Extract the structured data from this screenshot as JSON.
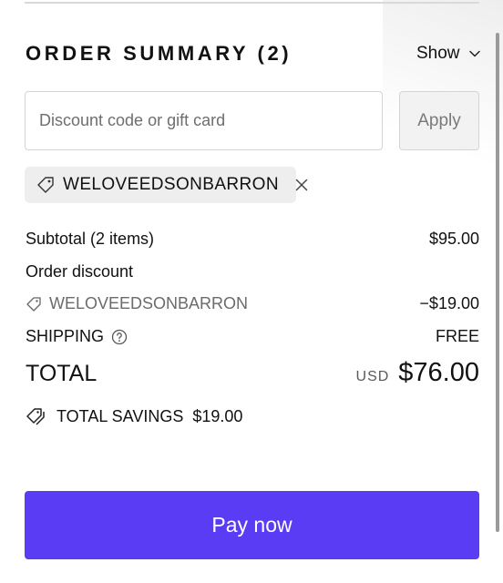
{
  "summary": {
    "title": "ORDER SUMMARY (2)",
    "toggle_label": "Show"
  },
  "discount": {
    "placeholder": "Discount code or gift card",
    "value": "",
    "apply_label": "Apply"
  },
  "applied_code": {
    "code": "WELOVEEDSONBARRON"
  },
  "lines": {
    "subtotal_label": "Subtotal (2 items)",
    "subtotal_value": "$95.00",
    "order_discount_label": "Order discount",
    "discount_code": "WELOVEEDSONBARRON",
    "discount_value": "−$19.00",
    "shipping_label": "SHIPPING",
    "shipping_value": "FREE"
  },
  "total": {
    "label": "TOTAL",
    "currency": "USD",
    "amount": "$76.00"
  },
  "savings": {
    "label": "TOTAL SAVINGS",
    "amount": "$19.00"
  },
  "pay": {
    "label": "Pay now"
  },
  "colors": {
    "accent": "#5b3cf5",
    "chip_background": "#eeeeee",
    "muted_text": "#6b6b6b"
  },
  "icons": [
    "chevron-down-icon",
    "tag-icon",
    "close-icon",
    "help-circle-icon",
    "tags-icon"
  ]
}
